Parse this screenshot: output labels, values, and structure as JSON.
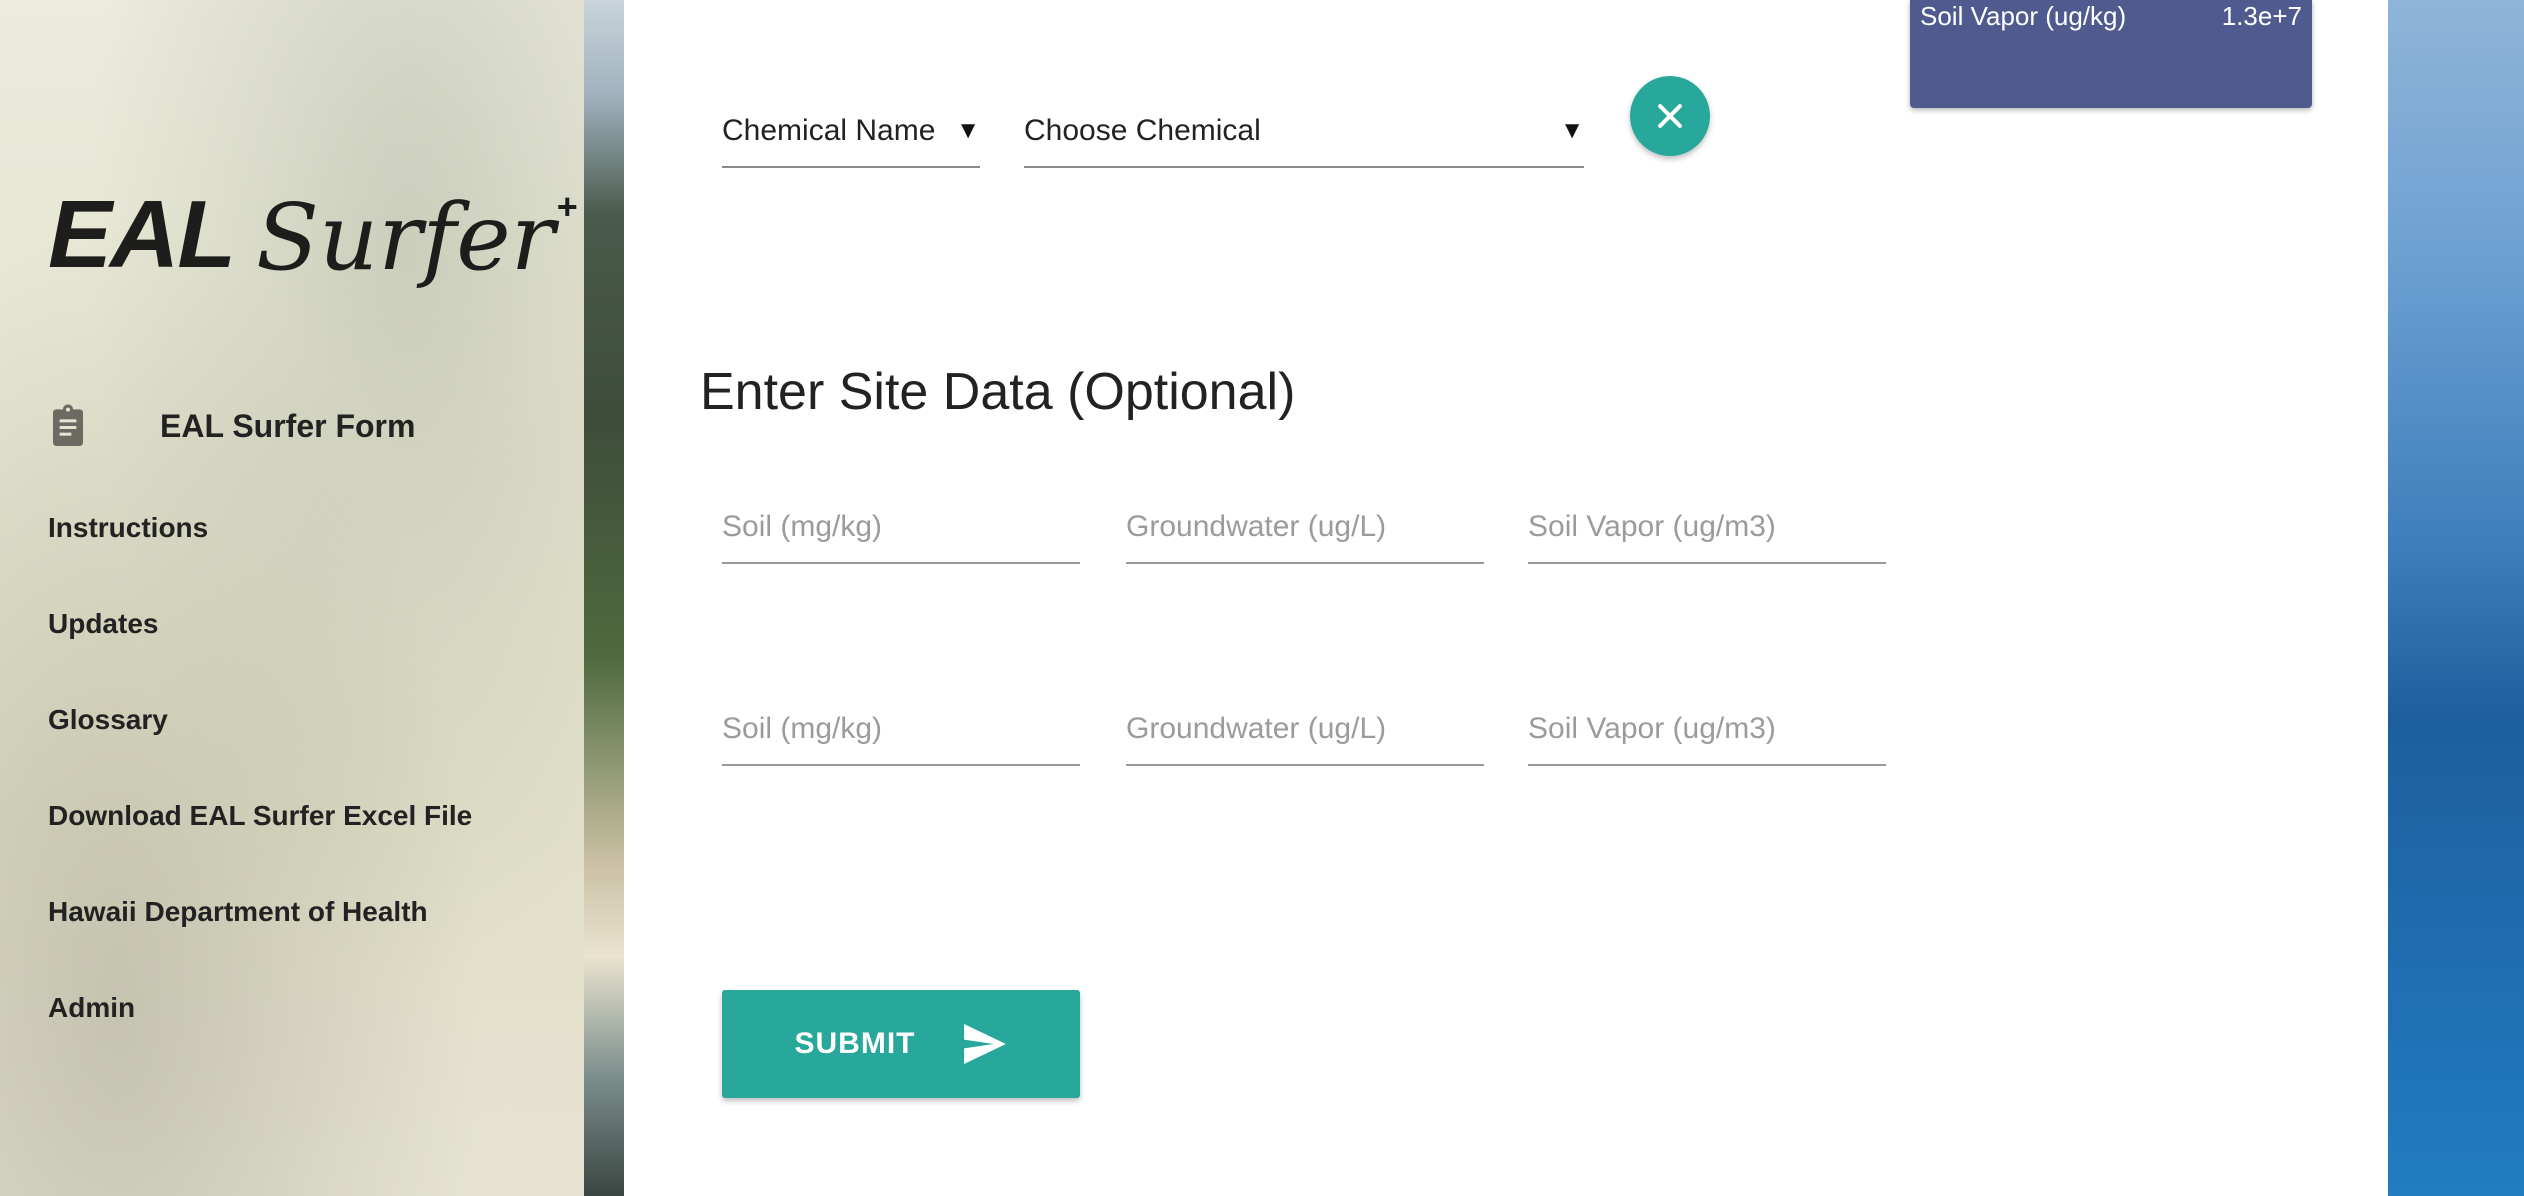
{
  "sidebar": {
    "logo": {
      "main": "EAL",
      "script": "Surfer",
      "superscript": "+"
    },
    "primary_item": {
      "label": "EAL Surfer Form",
      "icon": "clipboard-icon"
    },
    "items": [
      {
        "label": "Instructions"
      },
      {
        "label": "Updates"
      },
      {
        "label": "Glossary"
      },
      {
        "label": "Download EAL Surfer Excel File"
      },
      {
        "label": "Hawaii Department of Health"
      },
      {
        "label": "Admin"
      }
    ]
  },
  "chemical_select": {
    "type_value": "Chemical Name",
    "chemical_value": "Choose Chemical",
    "clear_icon": "close-icon"
  },
  "results_tooltip": {
    "label": "Soil Vapor (ug/kg)",
    "value": "1.3e+7"
  },
  "site_data": {
    "title": "Enter Site Data (Optional)",
    "rows": [
      {
        "soil_placeholder": "Soil (mg/kg)",
        "groundwater_placeholder": "Groundwater (ug/L)",
        "soil_vapor_placeholder": "Soil Vapor (ug/m3)"
      },
      {
        "soil_placeholder": "Soil (mg/kg)",
        "groundwater_placeholder": "Groundwater (ug/L)",
        "soil_vapor_placeholder": "Soil Vapor (ug/m3)"
      }
    ]
  },
  "submit": {
    "label": "SUBMIT",
    "icon": "send-icon"
  },
  "colors": {
    "accent": "#27a89a",
    "tooltip_bg": "#4f5b8e"
  }
}
